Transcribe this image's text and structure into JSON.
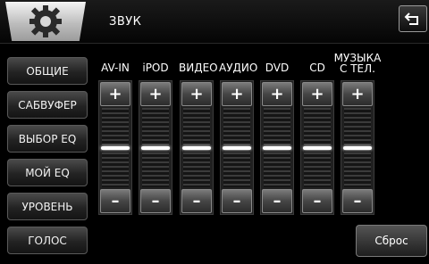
{
  "header": {
    "title": "ЗВУК",
    "settings_icon": "gear-icon",
    "back_icon": "return-arrow-icon"
  },
  "sidebar": {
    "items": [
      {
        "label": "ОБЩИЕ"
      },
      {
        "label": "САБВУФЕР"
      },
      {
        "label": "ВЫБОР EQ"
      },
      {
        "label": "МОЙ EQ"
      },
      {
        "label": "УРОВЕНЬ"
      },
      {
        "label": "ГОЛОС"
      }
    ]
  },
  "levels": {
    "plus_label": "+",
    "minus_label": "–",
    "channels": [
      {
        "label": "AV-IN",
        "level": 0.5
      },
      {
        "label": "iPOD",
        "level": 0.5
      },
      {
        "label": "ВИДЕО",
        "level": 0.5
      },
      {
        "label": "АУДИО",
        "level": 0.5
      },
      {
        "label": "DVD",
        "level": 0.5
      },
      {
        "label": "CD",
        "level": 0.5
      },
      {
        "label": "МУЗЫКА С ТЕЛ.",
        "label_line1": "МУЗЫКА",
        "label_line2": "С ТЕЛ.",
        "level": 0.5
      }
    ]
  },
  "footer": {
    "reset_label": "Сброс"
  }
}
